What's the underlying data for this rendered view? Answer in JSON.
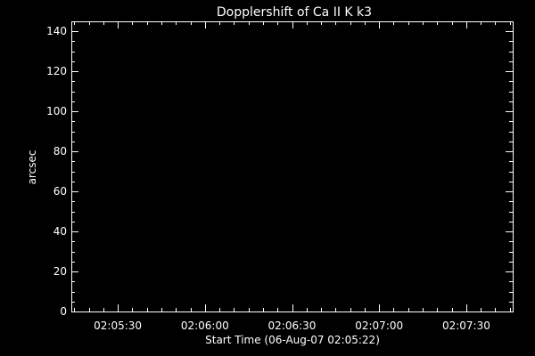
{
  "chart_data": {
    "type": "line",
    "title": "Dopplershift of Ca II K k3",
    "xlabel": "Start Time (06-Aug-07 02:05:22)",
    "ylabel": "arcsec",
    "x_start_seconds": 0,
    "xlim_seconds": [
      -8,
      144
    ],
    "ylim": [
      0,
      145
    ],
    "x_tick_labels": [
      {
        "label": "02:05:30",
        "t": 8
      },
      {
        "label": "02:06:00",
        "t": 38
      },
      {
        "label": "02:06:30",
        "t": 68
      },
      {
        "label": "02:07:00",
        "t": 98
      },
      {
        "label": "02:07:30",
        "t": 128
      }
    ],
    "y_ticks": [
      0,
      20,
      40,
      60,
      80,
      100,
      120,
      140
    ],
    "series": [],
    "background_color": "#000000",
    "foreground_color": "#ffffff",
    "grid": false
  }
}
